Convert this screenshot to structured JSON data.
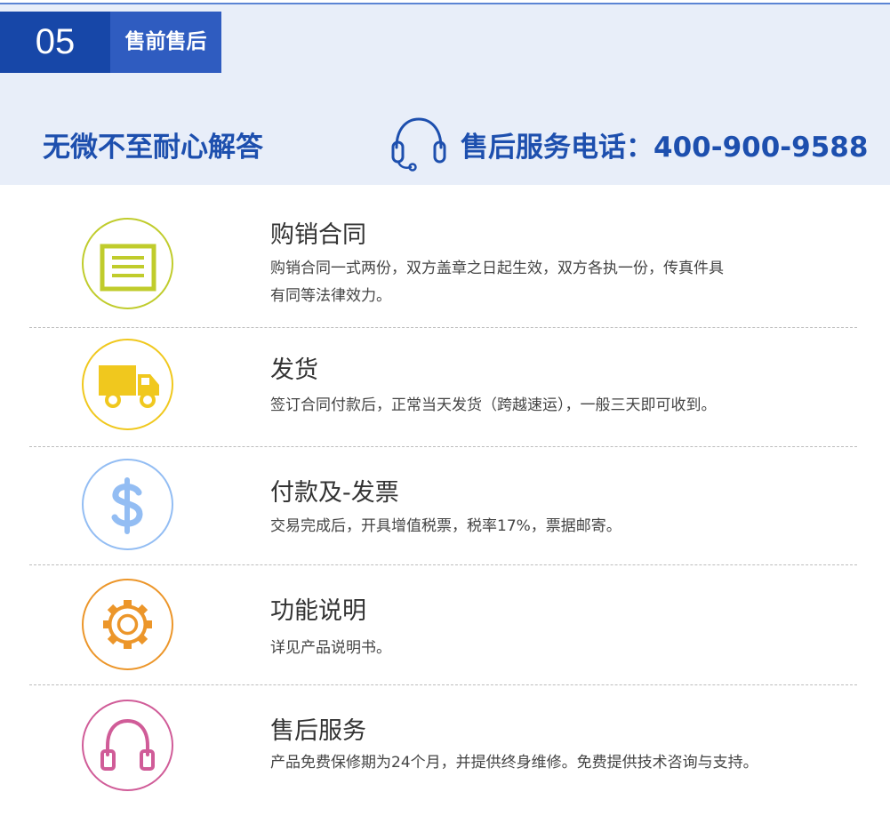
{
  "section": {
    "number": "05",
    "title": "售前售后"
  },
  "banner": {
    "slogan": "无微不至耐心解答",
    "hotline": "售后服务电话：400-900-9588"
  },
  "items": [
    {
      "icon": "document-icon",
      "color": "#c0cc2c",
      "title": "购销合同",
      "desc_line1": "购销合同一式两份，双方盖章之日起生效，双方各执一份，传真件具",
      "desc_line2": "有同等法律效力。"
    },
    {
      "icon": "truck-icon",
      "color": "#f0c81e",
      "title": "发货",
      "desc_line1": "签订合同付款后，正常当天发货（跨越速运），一般三天即可收到。"
    },
    {
      "icon": "dollar-icon",
      "color": "#93bdf3",
      "title": "付款及-发票",
      "desc_line1": "交易完成后，开具增值税票，税率17%，票据邮寄。"
    },
    {
      "icon": "gear-icon",
      "color": "#ec962a",
      "title": "功能说明",
      "desc_line1": "详见产品说明书。"
    },
    {
      "icon": "headphones-icon",
      "color": "#d05c98",
      "title": "售后服务",
      "desc_line1": "产品免费保修期为24个月，并提供终身维修。免费提供技术咨询与支持。"
    }
  ]
}
